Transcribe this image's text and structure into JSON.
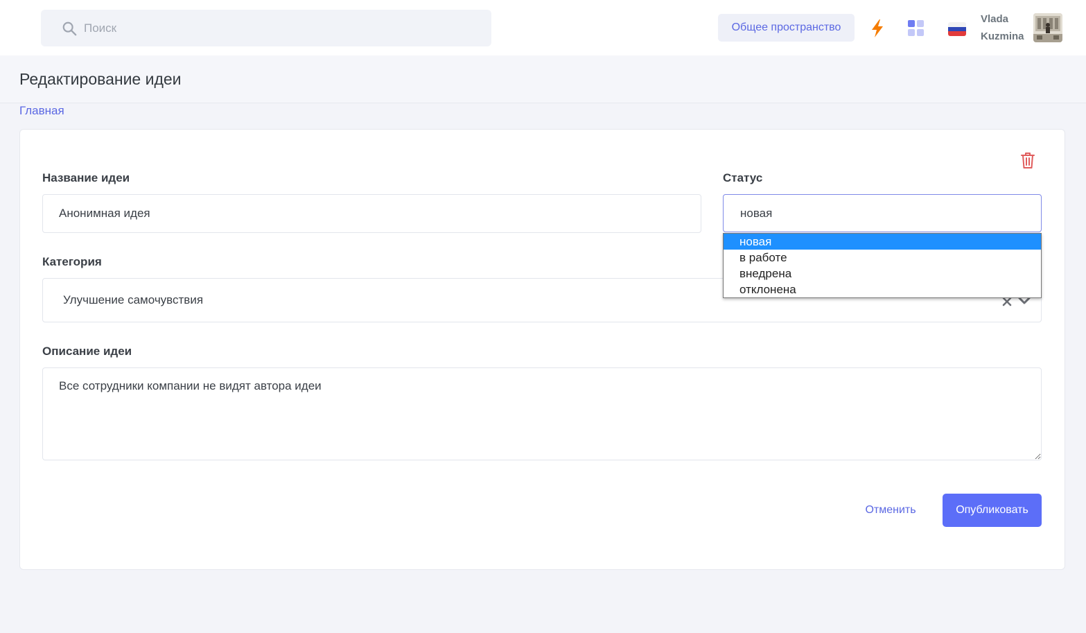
{
  "header": {
    "search_placeholder": "Поиск",
    "workspace_label": "Общее пространство",
    "user_name": "Vlada Kuzmina"
  },
  "page": {
    "title": "Редактирование идеи",
    "breadcrumb": "Главная"
  },
  "form": {
    "name_label": "Название идеи",
    "name_value": "Анонимная идея",
    "status_label": "Статус",
    "status_value": "новая",
    "status_options": [
      "новая",
      "в работе",
      "внедрена",
      "отклонена"
    ],
    "category_label": "Категория",
    "category_value": "Улучшение самочувствия",
    "description_label": "Описание идеи",
    "description_value": "Все сотрудники компании не видят автора идеи",
    "cancel_label": "Отменить",
    "publish_label": "Опубликовать"
  },
  "colors": {
    "accent": "#5c6ef8",
    "link": "#5b68e3",
    "bolt": "#f57c00",
    "danger": "#e05d5d",
    "dropdown_selected": "#1e90ff"
  },
  "icons": [
    "search-icon",
    "bolt-icon",
    "apps-icon",
    "flag-icon",
    "trash-icon",
    "clear-icon",
    "chevron-down-icon"
  ]
}
